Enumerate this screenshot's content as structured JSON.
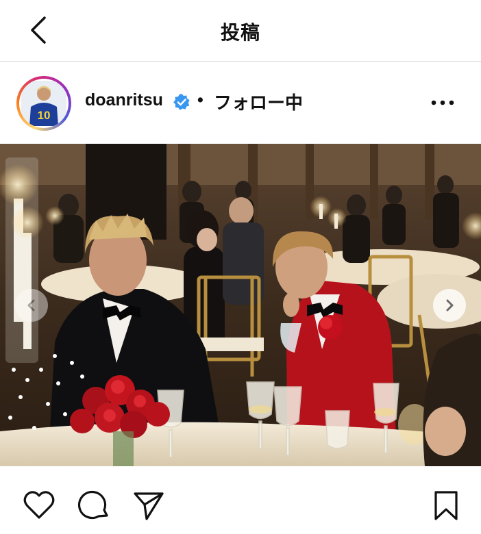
{
  "header": {
    "title": "投稿"
  },
  "post": {
    "username": "doanritsu",
    "verified": true,
    "separator": "•",
    "follow_status": "フォロー中",
    "avatar_jersey_number": "10"
  },
  "media": {
    "carousel": true
  },
  "colors": {
    "verified_badge": "#3897f0",
    "text": "#111111",
    "divider": "#dbdbdb",
    "background": "#ffffff"
  },
  "icons": {
    "back": "chevron-left-icon",
    "verified": "verified-badge-icon",
    "more": "more-options-icon",
    "like": "heart-icon",
    "comment": "comment-icon",
    "share": "paper-plane-icon",
    "save": "bookmark-icon",
    "carousel_prev": "chevron-left-icon",
    "carousel_next": "chevron-right-icon"
  }
}
